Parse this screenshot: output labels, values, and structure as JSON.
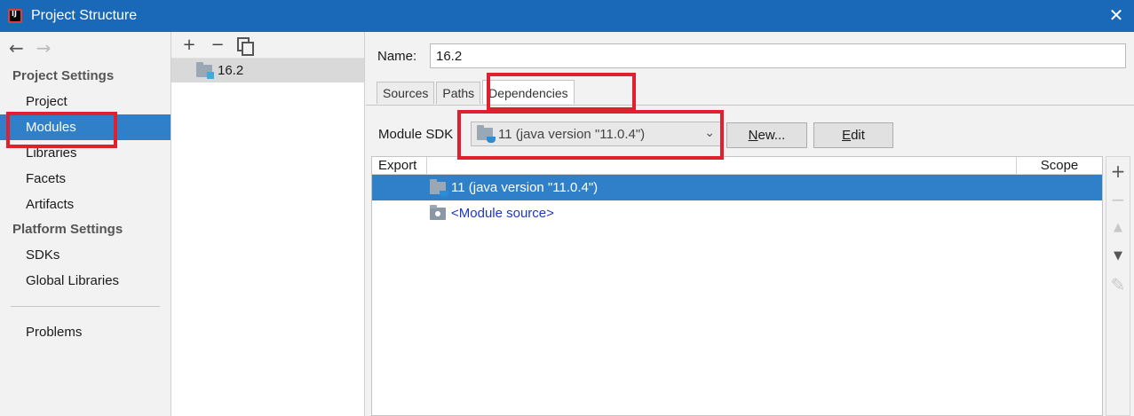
{
  "window": {
    "title": "Project Structure",
    "close_icon": "close-icon"
  },
  "sidebar": {
    "project_settings_header": "Project Settings",
    "project_settings_items": [
      {
        "label": "Project"
      },
      {
        "label": "Modules",
        "selected": true
      },
      {
        "label": "Libraries"
      },
      {
        "label": "Facets"
      },
      {
        "label": "Artifacts"
      }
    ],
    "platform_settings_header": "Platform Settings",
    "platform_settings_items": [
      {
        "label": "SDKs"
      },
      {
        "label": "Global Libraries"
      }
    ],
    "problems_label": "Problems"
  },
  "modules_panel": {
    "toolbar": {
      "add_icon": "+",
      "remove_icon": "−"
    },
    "modules": [
      {
        "name": "16.2"
      }
    ]
  },
  "module_editor": {
    "name_label": "Name:",
    "name_value": "16.2",
    "tabs": [
      {
        "label": "Sources"
      },
      {
        "label": "Paths"
      },
      {
        "label": "Dependencies",
        "active": true
      }
    ],
    "module_sdk_label": "Module SDK",
    "module_sdk_value": "11 (java version \"11.0.4\")",
    "new_button_label": "New...",
    "edit_button_label": "Edit",
    "table": {
      "columns": [
        "Export",
        "Scope"
      ],
      "rows": [
        {
          "label": "11 (java version \"11.0.4\")",
          "selected": true
        },
        {
          "label": "<Module source>"
        }
      ]
    }
  },
  "colors": {
    "title_bar": "#1a69b8",
    "selection": "#2f7fc9",
    "highlight": "#e0202e",
    "link": "#1e37c2"
  }
}
